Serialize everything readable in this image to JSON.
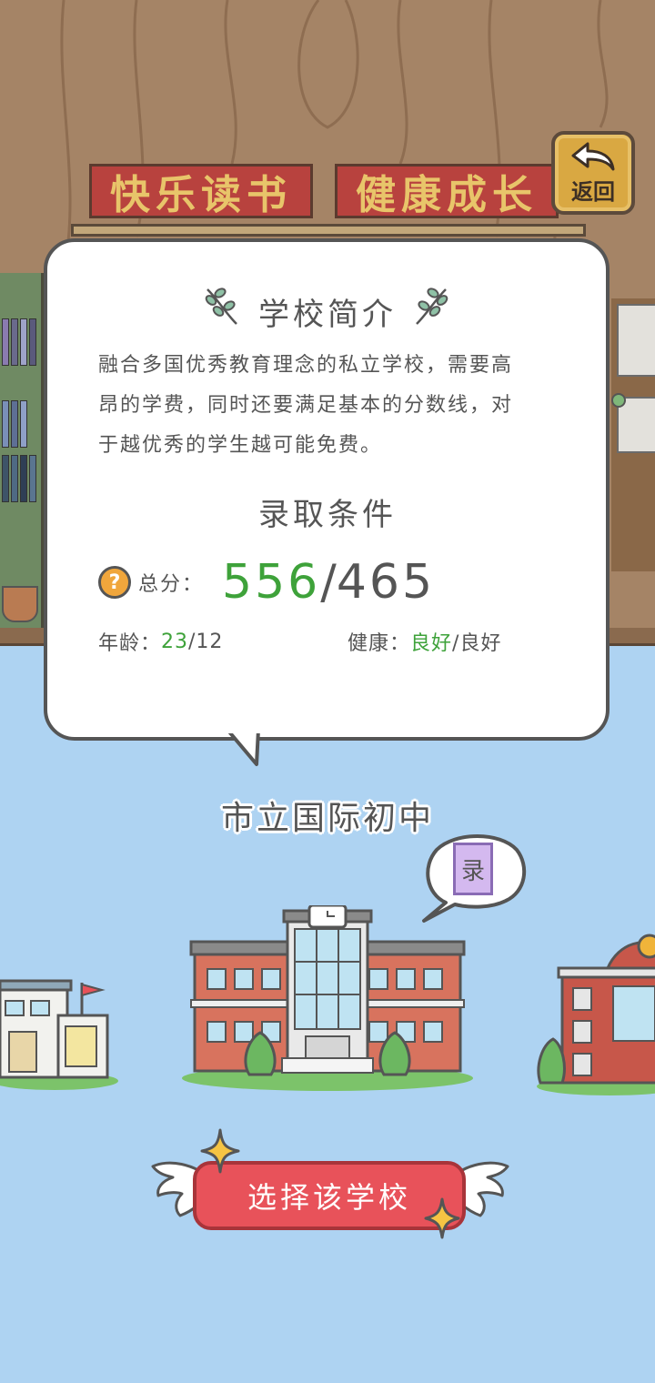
{
  "header": {
    "banner_left": "快乐读书",
    "banner_right": "健康成长",
    "back_label": "返回"
  },
  "card": {
    "title": "学校简介",
    "description_lines": [
      "融合多国优秀教育理念的私立学校，需要高",
      "昂的学费，同时还要满足基本的分数线，对",
      "于越优秀的学生越可能免费。"
    ],
    "requirements_title": "录取条件",
    "score": {
      "label": "总分：",
      "current": "556",
      "separator": "/",
      "required": "465"
    },
    "age": {
      "label": "年龄：",
      "current": "23",
      "required": "/12"
    },
    "health": {
      "label": "健康：",
      "current": "良好",
      "required": "/良好"
    }
  },
  "school": {
    "name": "市立国际初中",
    "tag": "录"
  },
  "select_button": "选择该学校",
  "colors": {
    "accent_green": "#3ea23a",
    "button_red": "#e8525a",
    "banner_red": "#b8423e",
    "sky_blue": "#aed3f2"
  },
  "icons": {
    "back": "back-arrow-icon",
    "help": "question-icon",
    "decor": "leaf-sprig-icon"
  }
}
